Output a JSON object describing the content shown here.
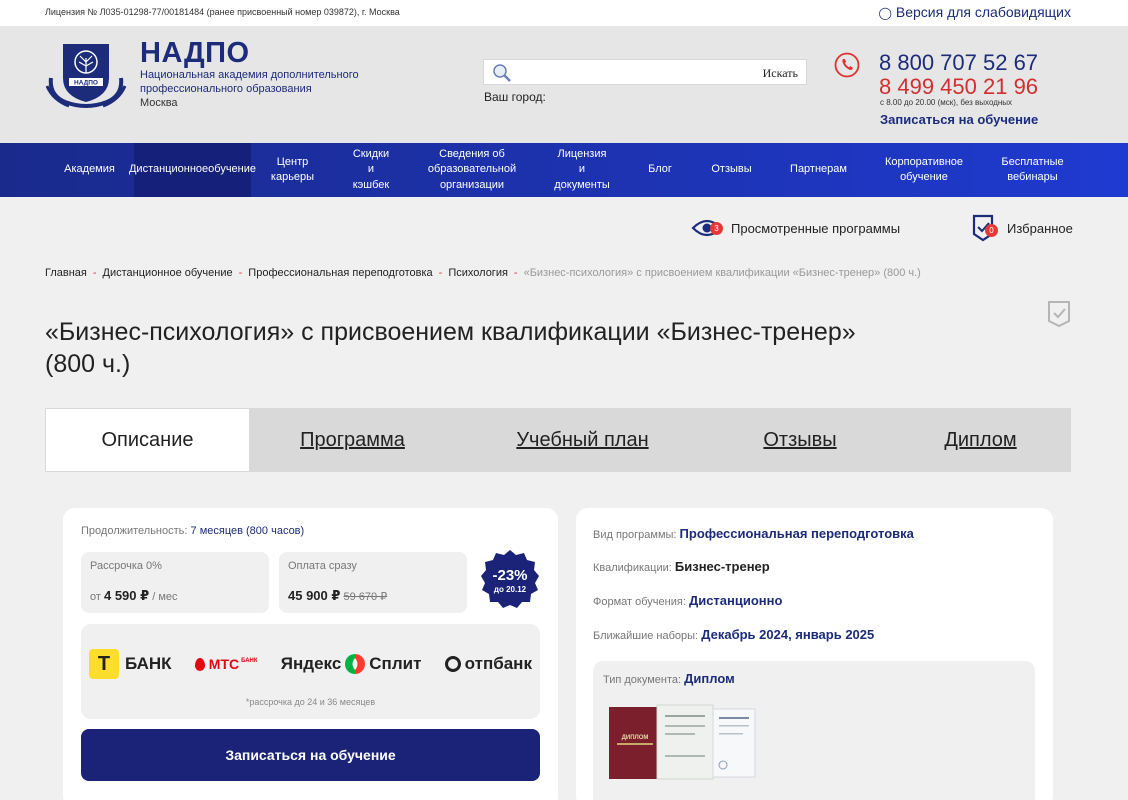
{
  "topbar": {
    "license": "Лицензия № Л035-01298-77/00181484 (ранее присвоенный номер 039872), г. Москва",
    "vision_link": "Версия для слабовидящих"
  },
  "header": {
    "brand_name": "НАДПО",
    "brand_sub": "Национальная академия дополнительного профессионального образования",
    "city_name": "Москва",
    "logo_text": "НАДПО",
    "search_placeholder": "",
    "search_button": "Искать",
    "city_label": "Ваш город:",
    "phone_primary": "8 800 707 52 67",
    "phone_secondary": "8 499 450 21 96",
    "hours": "с 8.00 до 20.00 (мск), без выходных",
    "enroll_link": "Записаться на обучение"
  },
  "nav": [
    {
      "label": "Академия",
      "lines": [
        "Академия"
      ]
    },
    {
      "label": "Дистанционное обучение",
      "lines": [
        "Дистанционное",
        "обучение"
      ]
    },
    {
      "label": "Центр карьеры",
      "lines": [
        "Центр",
        "карьеры"
      ]
    },
    {
      "label": "Скидки и кэшбек",
      "lines": [
        "Скидки",
        "и",
        "кэшбек"
      ]
    },
    {
      "label": "Сведения об образовательной организации",
      "lines": [
        "Сведения об",
        "образовательной",
        "организации"
      ]
    },
    {
      "label": "Лицензия и документы",
      "lines": [
        "Лицензия",
        "и",
        "документы"
      ]
    },
    {
      "label": "Блог",
      "lines": [
        "Блог"
      ]
    },
    {
      "label": "Отзывы",
      "lines": [
        "Отзывы"
      ]
    },
    {
      "label": "Партнерам",
      "lines": [
        "Партнерам"
      ]
    },
    {
      "label": "Корпоративное обучение",
      "lines": [
        "Корпоративное",
        "обучение"
      ]
    },
    {
      "label": "Бесплатные вебинары",
      "lines": [
        "Бесплатные",
        "вебинары"
      ]
    }
  ],
  "nav_active_index": 1,
  "toolbar": {
    "viewed_label": "Просмотренные программы",
    "viewed_count": "3",
    "favorites_label": "Избранное",
    "favorites_count": "0"
  },
  "breadcrumb": [
    "Главная",
    "Дистанционное обучение",
    "Профессиональная переподготовка",
    "Психология",
    "«Бизнес-психология» с присвоением квалификации «Бизнес-тренер» (800 ч.)"
  ],
  "page_title": "«Бизнес-психология» с присвоением квалификации «Бизнес-тренер» (800 ч.)",
  "tabs": [
    "Описание",
    "Программа",
    "Учебный план",
    "Отзывы",
    "Диплом"
  ],
  "tabs_active_index": 0,
  "pricing": {
    "duration_label": "Продолжительность:",
    "duration_value": "7 месяцев (800 часов)",
    "installment_label": "Рассрочка 0%",
    "installment_prefix": "от",
    "installment_price": "4 590 ₽",
    "installment_suffix": "/ мес",
    "full_label": "Оплата сразу",
    "full_price": "45 900 ₽",
    "full_old_price": "59 670 ₽",
    "discount_value": "-23%",
    "discount_until": "до 20.12"
  },
  "banks": {
    "tbank_letter": "Т",
    "tbank": "БАНК",
    "mts": "МТС",
    "mts_sub": "БАНК",
    "yandex": "Яндекс",
    "split": "Сплит",
    "otp": "отпбанк",
    "note": "*рассрочка до 24 и 36 месяцев"
  },
  "enroll_button": "Записаться на обучение",
  "program_info": {
    "type_label": "Вид программы:",
    "type_value": "Профессиональная переподготовка",
    "qual_label": "Квалификации:",
    "qual_value": "Бизнес-тренер",
    "format_label": "Формат обучения:",
    "format_value": "Дистанционно",
    "intake_label": "Ближайшие наборы:",
    "intake_value": "Декабрь 2024, январь 2025",
    "doc_label": "Тип документа:",
    "doc_value": "Диплом",
    "diploma_cover": "ДИПЛОМ"
  },
  "colors": {
    "brand": "#1c2b7a",
    "accent_red": "#d32f2f",
    "nav_start": "#1a2a8c",
    "nav_end": "#1f3ad0",
    "button": "#1a2377"
  }
}
